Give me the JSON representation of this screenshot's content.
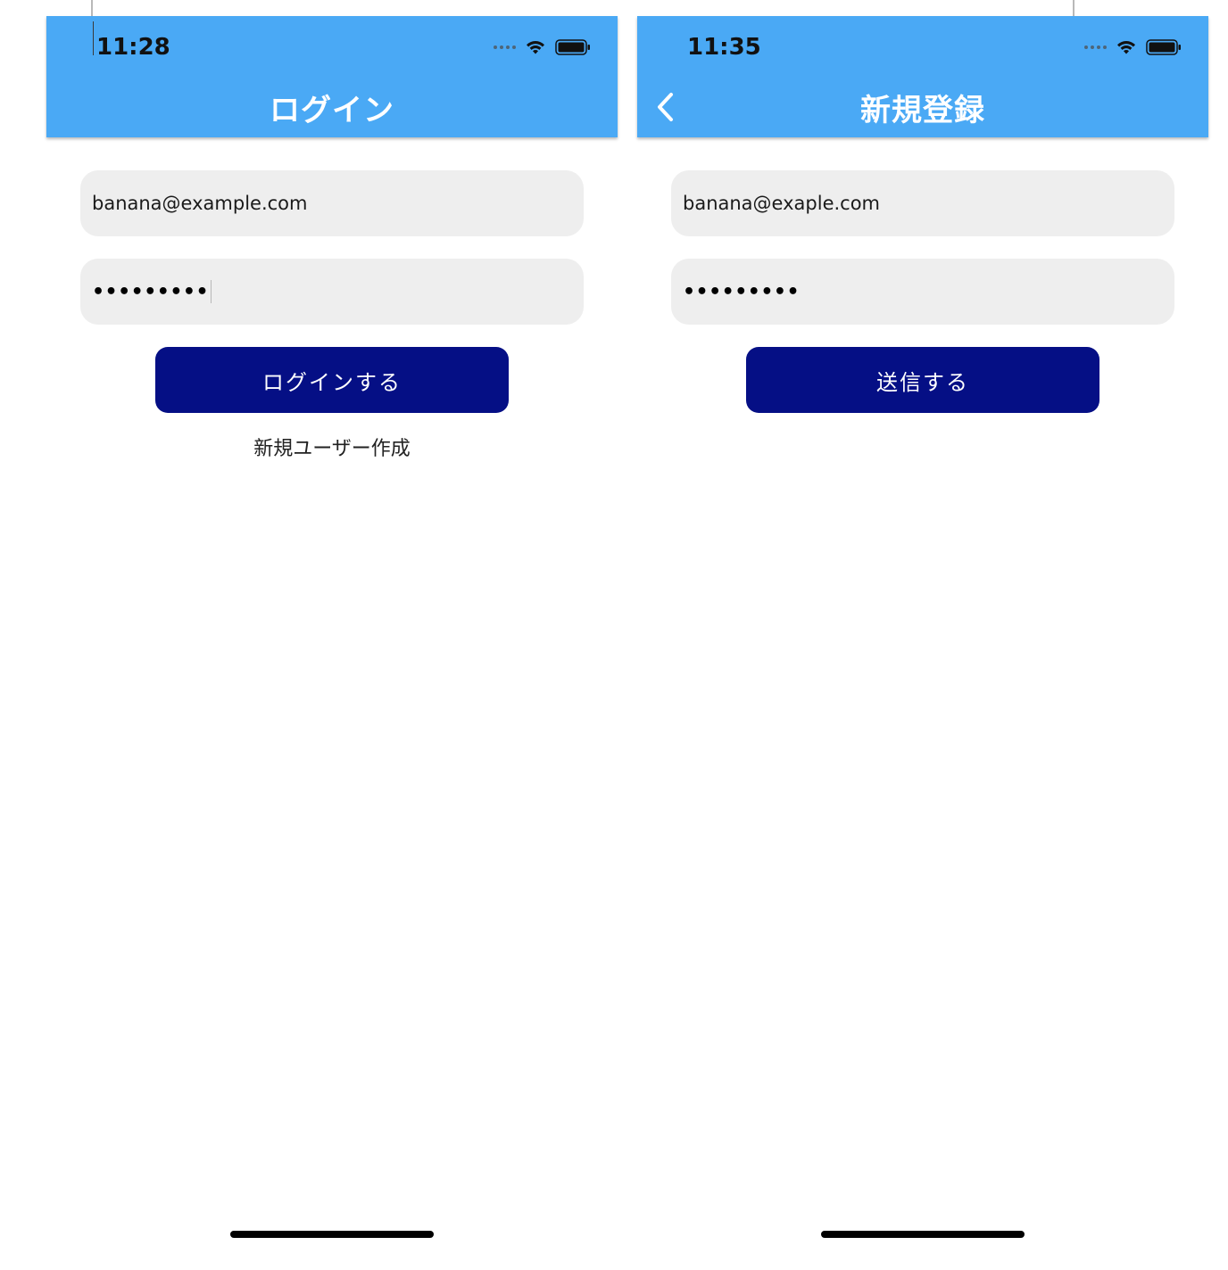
{
  "login_screen": {
    "status": {
      "time": "11:28"
    },
    "title": "ログイン",
    "email_value": "banana@example.com",
    "password_masked": "•••••••••",
    "submit_label": "ログインする",
    "signup_link": "新規ユーザー作成"
  },
  "signup_screen": {
    "status": {
      "time": "11:35"
    },
    "title": "新規登録",
    "email_value": "banana@exaple.com",
    "password_masked": "•••••••••",
    "submit_label": "送信する"
  },
  "icons": {
    "signal": "signal-dots-icon",
    "wifi": "wifi-icon",
    "battery": "battery-icon",
    "back": "chevron-left-icon"
  },
  "colors": {
    "navbar": "#4aa9f5",
    "primary_button": "#050f85",
    "field_background": "#eeeeee"
  }
}
